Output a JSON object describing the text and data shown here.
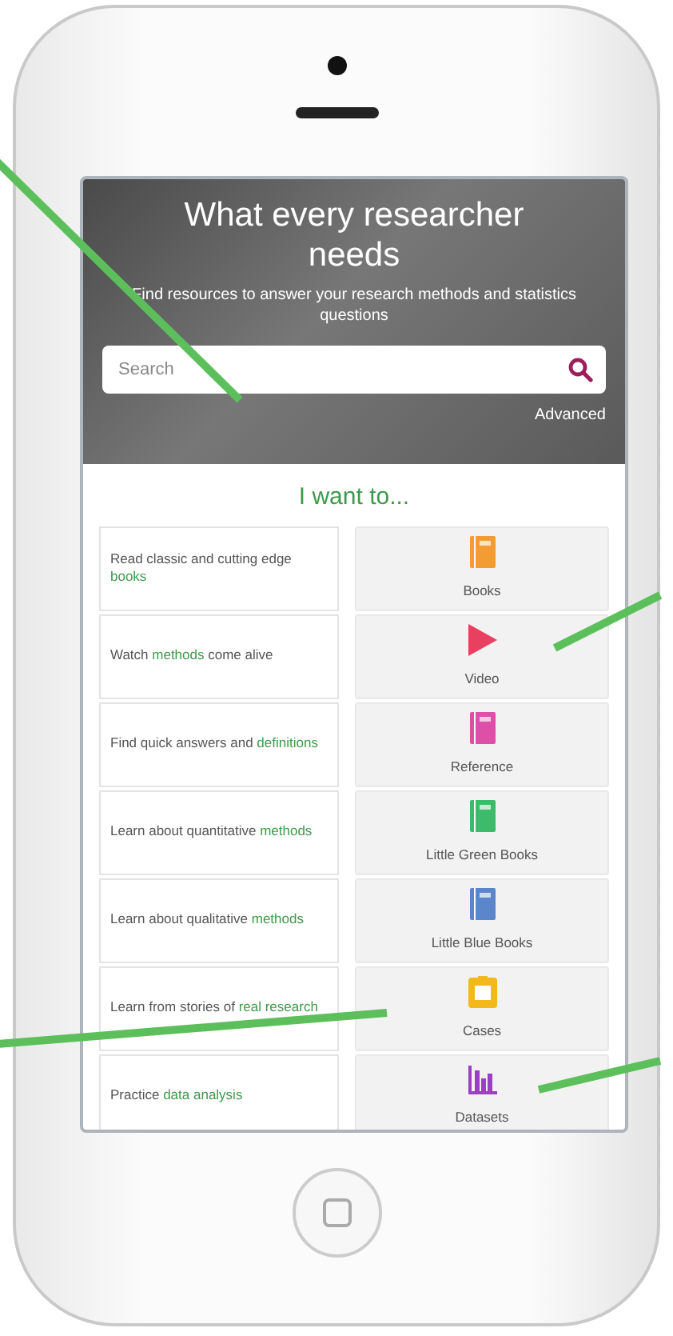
{
  "hero": {
    "title": "What every researcher needs",
    "subtitle": "Find resources to answer your research methods and statistics questions",
    "search": {
      "placeholder": "Search"
    },
    "advanced": "Advanced"
  },
  "heading": "I want to...",
  "items": [
    {
      "prompt": "Read classic and cutting edge **books**",
      "label": "Books",
      "kind": "book",
      "color": "#f39c33"
    },
    {
      "prompt": "Watch **methods** come alive",
      "label": "Video",
      "kind": "play",
      "color": "#e8415f"
    },
    {
      "prompt": "Find quick answers and **definitions**",
      "label": "Reference",
      "kind": "book",
      "color": "#de4fa8"
    },
    {
      "prompt": "Learn about quantitative **methods**",
      "label": "Little Green Books",
      "kind": "book",
      "color": "#3dbb6a"
    },
    {
      "prompt": "Learn about qualitative **methods**",
      "label": "Little Blue Books",
      "kind": "book",
      "color": "#5b86cc"
    },
    {
      "prompt": "Learn from stories of **real research**",
      "label": "Cases",
      "kind": "case",
      "color": "#f2b81c"
    },
    {
      "prompt": "Practice **data analysis**",
      "label": "Datasets",
      "kind": "chart",
      "color": "#9b3fc4"
    }
  ]
}
